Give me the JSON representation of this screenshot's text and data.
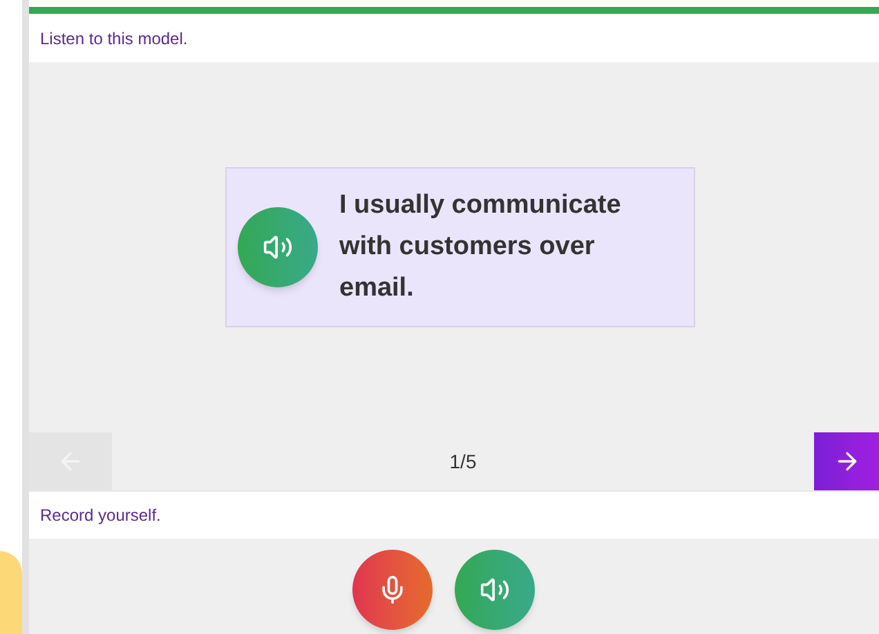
{
  "progress": {
    "level": 1
  },
  "listen": {
    "instruction": "Listen to this model.",
    "sentence": "I usually communicate with customers over email."
  },
  "pager": {
    "prev": {
      "disabled": true
    },
    "next": {
      "disabled": false
    },
    "counter": "1/5"
  },
  "record": {
    "instruction": "Record yourself."
  }
}
